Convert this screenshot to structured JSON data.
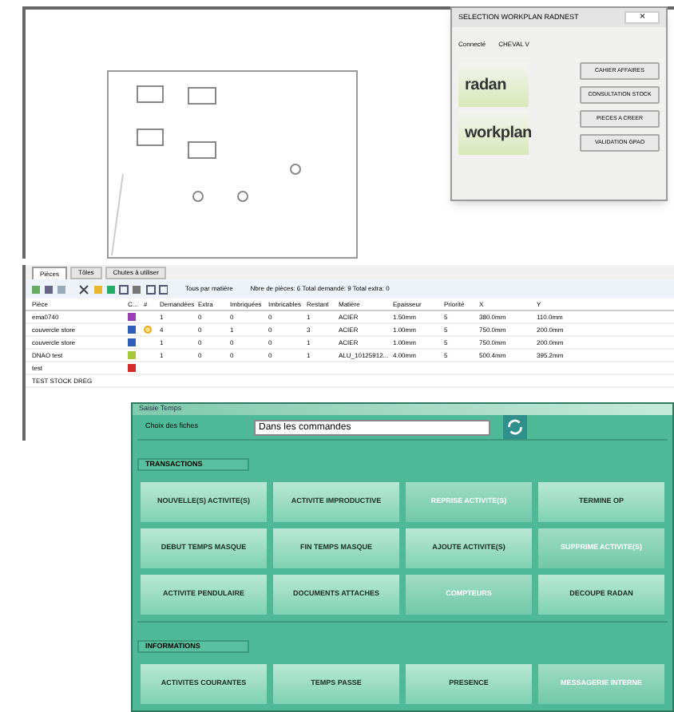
{
  "dialog": {
    "title": "SELECTION WORKPLAN RADNEST",
    "close": "×",
    "user_label": "Connecté",
    "user": "CHEVAL V",
    "logos": [
      "radan",
      "workplan"
    ],
    "buttons": [
      "CAHIER AFFAIRES",
      "CONSULTATION STOCK",
      "PIECES A CREER",
      "VALIDATION GPAO"
    ]
  },
  "tabs": [
    {
      "label": "Pièces",
      "selected": true
    },
    {
      "label": "Tôles",
      "selected": false
    },
    {
      "label": "Chutes à utiliser",
      "selected": false
    }
  ],
  "toolbar": {
    "sort": "Tous par matière",
    "summary": "Nbre de pièces: 6  Total demandé: 9  Total extra: 0"
  },
  "table": {
    "columns": [
      "Pièce",
      "C...",
      "#",
      "Demandées",
      "Extra",
      "Imbriquées",
      "Imbricables",
      "Restant",
      "Matière",
      "Epaisseur",
      "Priorité",
      "X",
      "Y"
    ],
    "rows": [
      {
        "name": "ema0740",
        "color": "#9b3fb5",
        "flag": false,
        "cells": [
          "1",
          "0",
          "0",
          "0",
          "1",
          "ACIER",
          "1.50mm",
          "5",
          "380.0mm",
          "110.0mm"
        ]
      },
      {
        "name": "couvercle store",
        "color": "#2f5fb8",
        "flag": true,
        "cells": [
          "4",
          "0",
          "1",
          "0",
          "3",
          "ACIER",
          "1.00mm",
          "5",
          "750.0mm",
          "200.0mm"
        ]
      },
      {
        "name": "couvercle store",
        "color": "#2f5fb8",
        "flag": false,
        "cells": [
          "1",
          "0",
          "0",
          "0",
          "1",
          "ACIER",
          "1.00mm",
          "5",
          "750.0mm",
          "200.0mm"
        ]
      },
      {
        "name": "DNAO test",
        "color": "#a8c83a",
        "flag": false,
        "cells": [
          "1",
          "0",
          "0",
          "0",
          "1",
          "ALU_10125912...",
          "4.00mm",
          "5",
          "500.4mm",
          "395.2mm"
        ]
      },
      {
        "name": "test",
        "color": "#d42a2a",
        "flag": false
      },
      {
        "name": "TEST STOCK DREG",
        "flag": false
      }
    ]
  },
  "window": {
    "title": "Saisie Temps",
    "field_label": "Choix des fiches",
    "field_value": "Dans les commandes",
    "sections": [
      {
        "title": "TRANSACTIONS",
        "buttons": [
          {
            "label": "NOUVELLE(S) ACTIVITE(S)",
            "disabled": false
          },
          {
            "label": "ACTIVITE IMPRODUCTIVE",
            "disabled": false
          },
          {
            "label": "REPRISE ACTIVITE(S)",
            "disabled": true
          },
          {
            "label": "TERMINE OP",
            "disabled": false
          },
          {
            "label": "DEBUT TEMPS MASQUE",
            "disabled": false
          },
          {
            "label": "FIN TEMPS MASQUE",
            "disabled": false
          },
          {
            "label": "AJOUTE ACTIVITE(S)",
            "disabled": false
          },
          {
            "label": "SUPPRIME ACTIVITE(S)",
            "disabled": true
          },
          {
            "label": "ACTIVITE PENDULAIRE",
            "disabled": false
          },
          {
            "label": "DOCUMENTS ATTACHES",
            "disabled": false
          },
          {
            "label": "COMPTEURS",
            "disabled": true
          },
          {
            "label": "DECOUPE RADAN",
            "disabled": false
          }
        ]
      },
      {
        "title": "INFORMATIONS",
        "buttons": [
          {
            "label": "ACTIVITES COURANTES",
            "disabled": false
          },
          {
            "label": "TEMPS PASSE",
            "disabled": false
          },
          {
            "label": "PRESENCE",
            "disabled": false
          },
          {
            "label": "MESSAGERIE INTERNE",
            "disabled": true
          }
        ]
      }
    ]
  }
}
